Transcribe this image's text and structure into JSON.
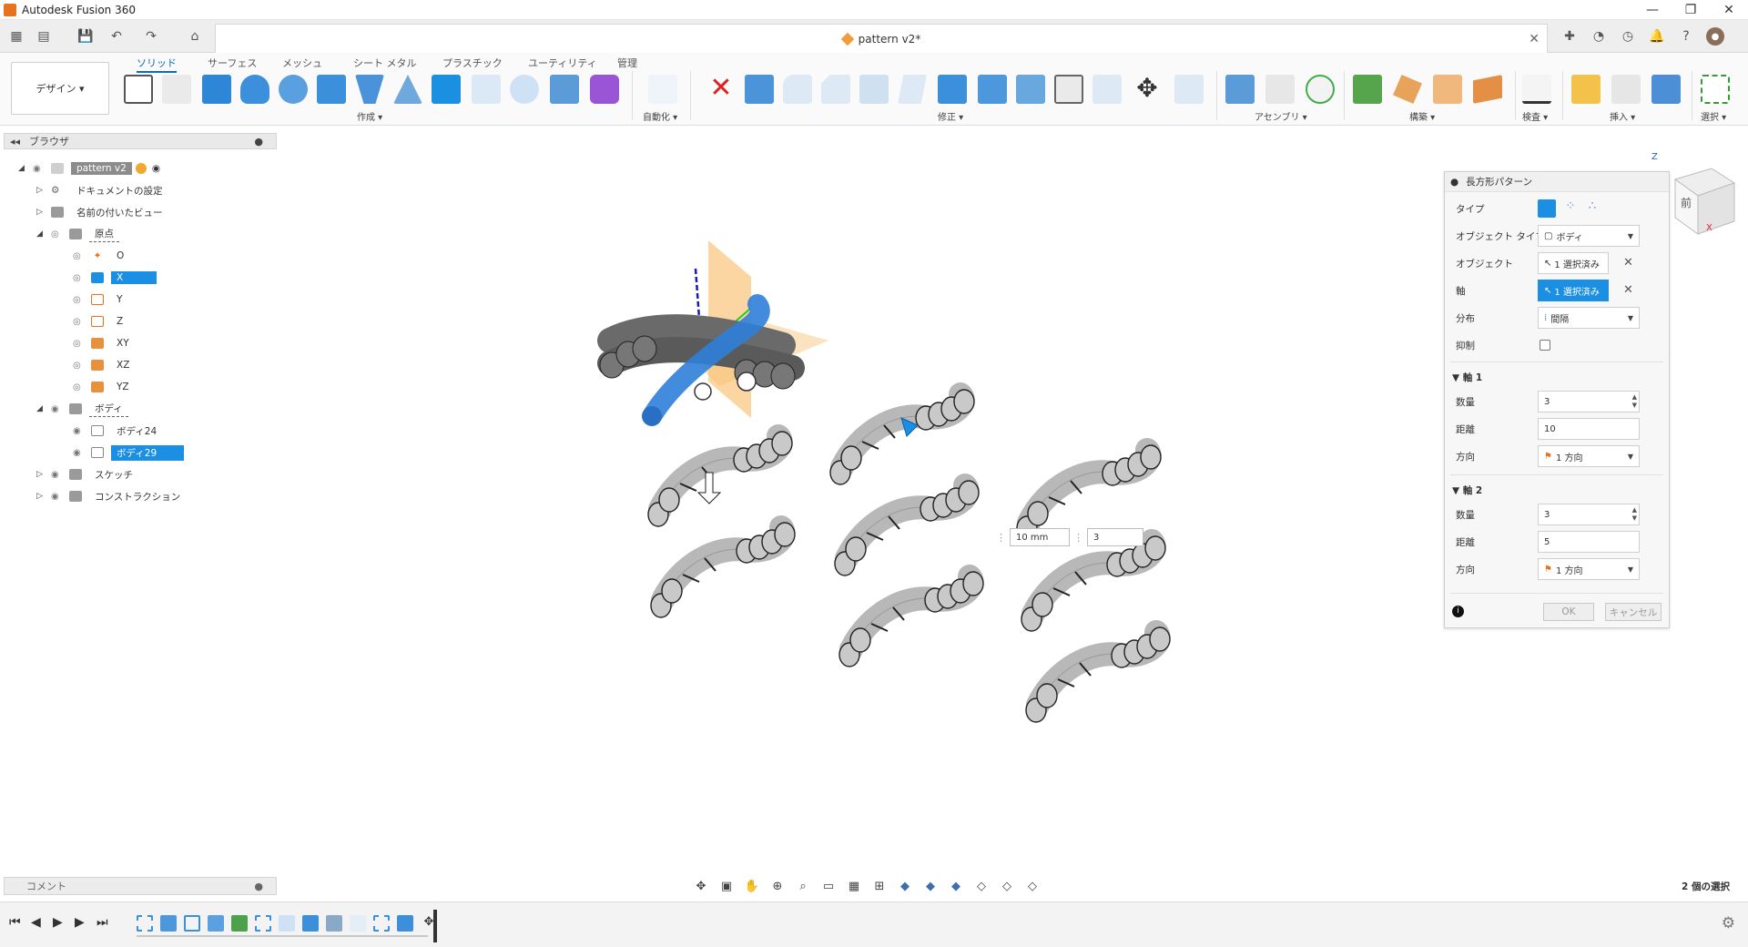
{
  "window": {
    "title": "Autodesk Fusion 360",
    "controls": [
      "—",
      "❐",
      "✕"
    ]
  },
  "document_tab": {
    "name": "pattern v2*"
  },
  "workspace_tabs": [
    "ソリッド",
    "サーフェス",
    "メッシュ",
    "シート メタル",
    "プラスチック",
    "ユーティリティ",
    "管理"
  ],
  "toolbar": {
    "design_label": "デザイン ▾",
    "groups": {
      "create": "作成 ▾",
      "automate": "自動化 ▾",
      "modify": "修正 ▾",
      "assemble": "アセンブリ ▾",
      "construct": "構築 ▾",
      "inspect": "検査 ▾",
      "insert": "挿入 ▾",
      "select": "選択 ▾"
    }
  },
  "browser": {
    "title": "ブラウザ",
    "items": [
      {
        "label": "pattern v2",
        "indent": 0,
        "expanded": true
      },
      {
        "label": "ドキュメントの設定",
        "indent": 1,
        "expanded": false
      },
      {
        "label": "名前の付いたビュー",
        "indent": 1,
        "expanded": false
      },
      {
        "label": "原点",
        "indent": 1,
        "expanded": true
      },
      {
        "label": "O",
        "indent": 2
      },
      {
        "label": "X",
        "indent": 2,
        "selected": true
      },
      {
        "label": "Y",
        "indent": 2
      },
      {
        "label": "Z",
        "indent": 2
      },
      {
        "label": "XY",
        "indent": 2
      },
      {
        "label": "XZ",
        "indent": 2
      },
      {
        "label": "YZ",
        "indent": 2
      },
      {
        "label": "ボディ",
        "indent": 1,
        "expanded": true
      },
      {
        "label": "ボディ24",
        "indent": 2
      },
      {
        "label": "ボディ29",
        "indent": 2,
        "selected": true
      },
      {
        "label": "スケッチ",
        "indent": 1,
        "expanded": false
      },
      {
        "label": "コンストラクション",
        "indent": 1,
        "expanded": false
      }
    ]
  },
  "dialog": {
    "title": "長方形パターン",
    "type_label": "タイプ",
    "object_type_label": "オブジェクト タイプ",
    "object_type_value": "ボディ",
    "objects_label": "オブジェクト",
    "objects_value": "1 選択済み",
    "axis_label": "軸",
    "axis_value": "1 選択済み",
    "distribution_label": "分布",
    "distribution_value": "間隔",
    "suppress_label": "抑制",
    "axis1": {
      "title": "軸 1",
      "quantity_label": "数量",
      "quantity_value": "3",
      "distance_label": "距離",
      "distance_value": "10",
      "direction_label": "方向",
      "direction_value": "1 方向"
    },
    "axis2": {
      "title": "軸 2",
      "quantity_label": "数量",
      "quantity_value": "3",
      "distance_label": "距離",
      "distance_value": "5",
      "direction_label": "方向",
      "direction_value": "1 方向"
    },
    "ok_label": "OK",
    "cancel_label": "キャンセル"
  },
  "inline_input": {
    "distance": "10 mm",
    "quantity": "3"
  },
  "comment": {
    "label": "コメント"
  },
  "status": {
    "selection_count": "2 個の選択"
  },
  "viewcube": {
    "face_label": "前",
    "axis_z": "Z",
    "axis_x": "X"
  },
  "colors": {
    "accent": "#1a8fe3",
    "orange": "#f29a3c",
    "body_gray": "#b8b8b8",
    "highlight_body": "#2f7fd9"
  }
}
